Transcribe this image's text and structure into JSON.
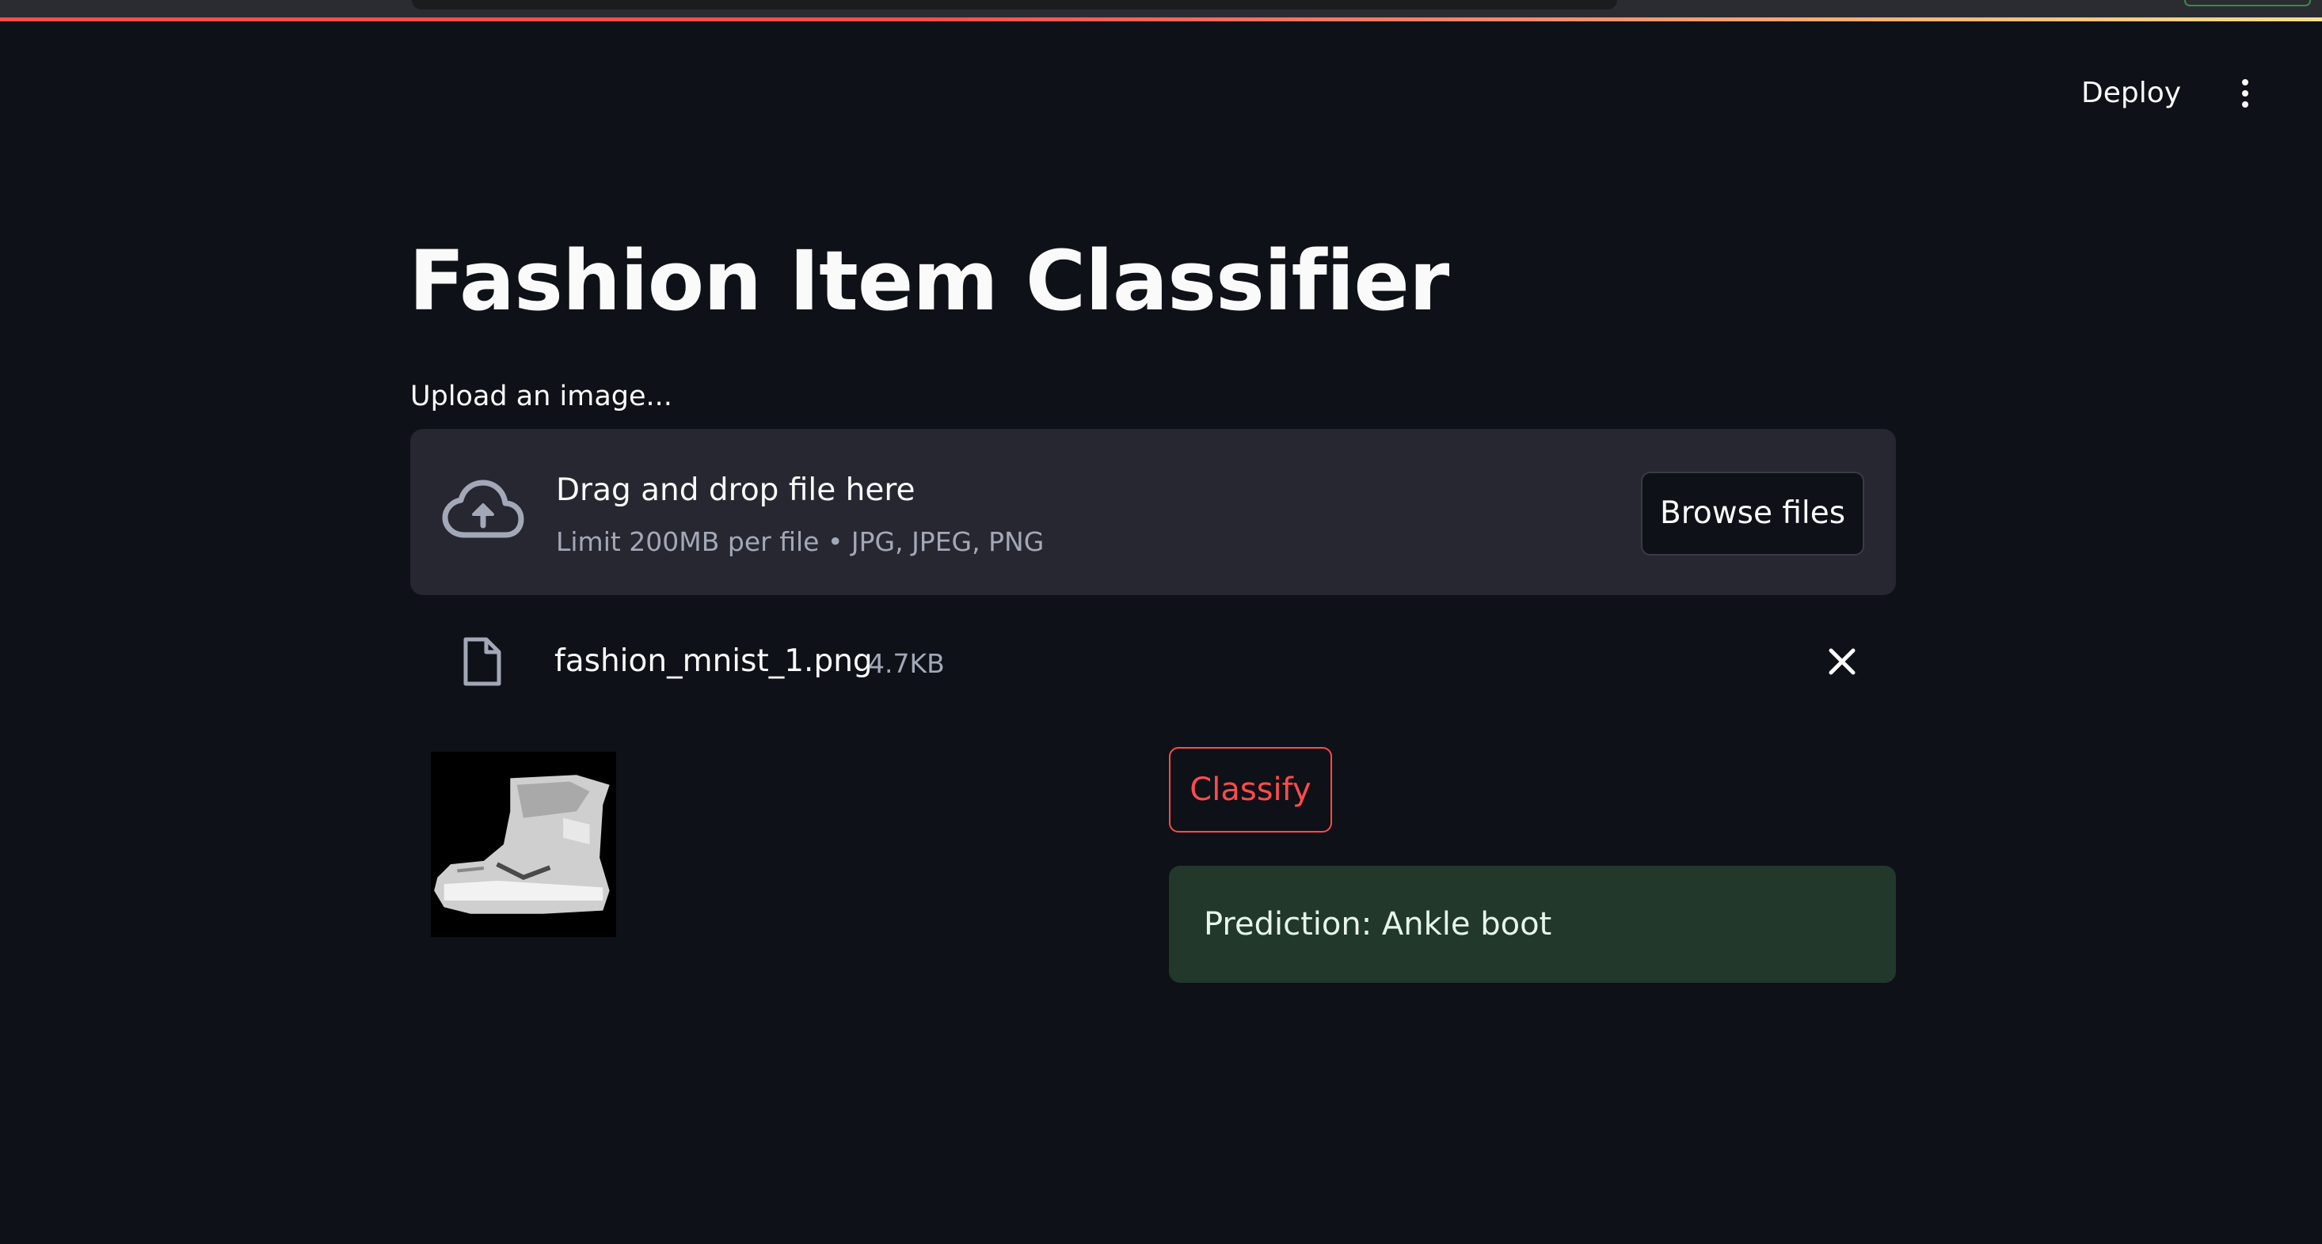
{
  "header": {
    "deploy_label": "Deploy",
    "menu_icon": "kebab-menu-icon"
  },
  "main": {
    "title": "Fashion Item Classifier",
    "upload_label": "Upload an image...",
    "dropzone": {
      "title": "Drag and drop file here",
      "subtitle": "Limit 200MB per file • JPG, JPEG, PNG",
      "browse_label": "Browse files",
      "icon": "cloud-upload-icon"
    },
    "uploaded_file": {
      "name": "fashion_mnist_1.png",
      "size": "4.7KB",
      "icon": "file-icon",
      "remove_icon": "close-icon"
    },
    "classify_label": "Classify",
    "prediction_text": "Prediction: Ankle boot"
  },
  "colors": {
    "background": "#0e1117",
    "dropzone_bg": "#262730",
    "accent": "#ff4b4b",
    "success_bg": "#21382a"
  }
}
